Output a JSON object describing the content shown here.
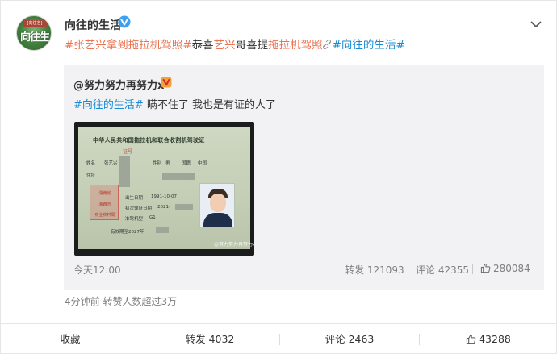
{
  "post": {
    "author": "向往的生活",
    "avatar": {
      "badge_text": "[向往名]",
      "logo_text": "向往生活"
    },
    "text_parts": [
      {
        "text": "#张艺兴拿到拖拉机驾照#",
        "kind": "tag"
      },
      {
        "text": "恭喜",
        "kind": "plain"
      },
      {
        "text": "艺兴",
        "kind": "tag"
      },
      {
        "text": "哥喜提",
        "kind": "plain"
      },
      {
        "text": "拖拉机驾照",
        "kind": "tag"
      },
      {
        "text": "#向往的生活#",
        "kind": "topic"
      }
    ],
    "meta_line": "4分钟前 转赞人数超过3万"
  },
  "repost": {
    "user": "@努力努力再努力x",
    "text_topic": "#向往的生活#",
    "text_body": " 瞒不住了 我也是有证的人了",
    "time": "今天12:00",
    "forward": "转发 121093",
    "comment": "评论 42355",
    "like": "280084",
    "image": {
      "card_title": "中华人民共和国拖拉机和联合收割机驾驶证",
      "card_sub": "证号",
      "name_label": "姓名",
      "name_value": "张艺兴",
      "sex_label": "性别",
      "sex_value": "男",
      "nation_label": "国籍",
      "nation_value": "中国",
      "address_label": "住址",
      "birth_label": "出生日期",
      "birth_value": "1991-10-07",
      "issue_label": "初次领证日期",
      "issue_value": "2021-",
      "class_label": "准驾机型",
      "class_value": "G1",
      "valid_label": "有效期至",
      "valid_value": "有效期至2027年",
      "stamp_top": "湖南省",
      "stamp_mid": "湘西市",
      "stamp_bottom": "农业农村局",
      "watermark": "@努力努力再努力x"
    }
  },
  "actions": {
    "favorite": "收藏",
    "forward": "转发 4032",
    "comment": "评论 2463",
    "like": "43288"
  },
  "colors": {
    "tag": "#eb7350",
    "topic": "#1a8bd2",
    "repost_bg": "#f2f2f5"
  }
}
